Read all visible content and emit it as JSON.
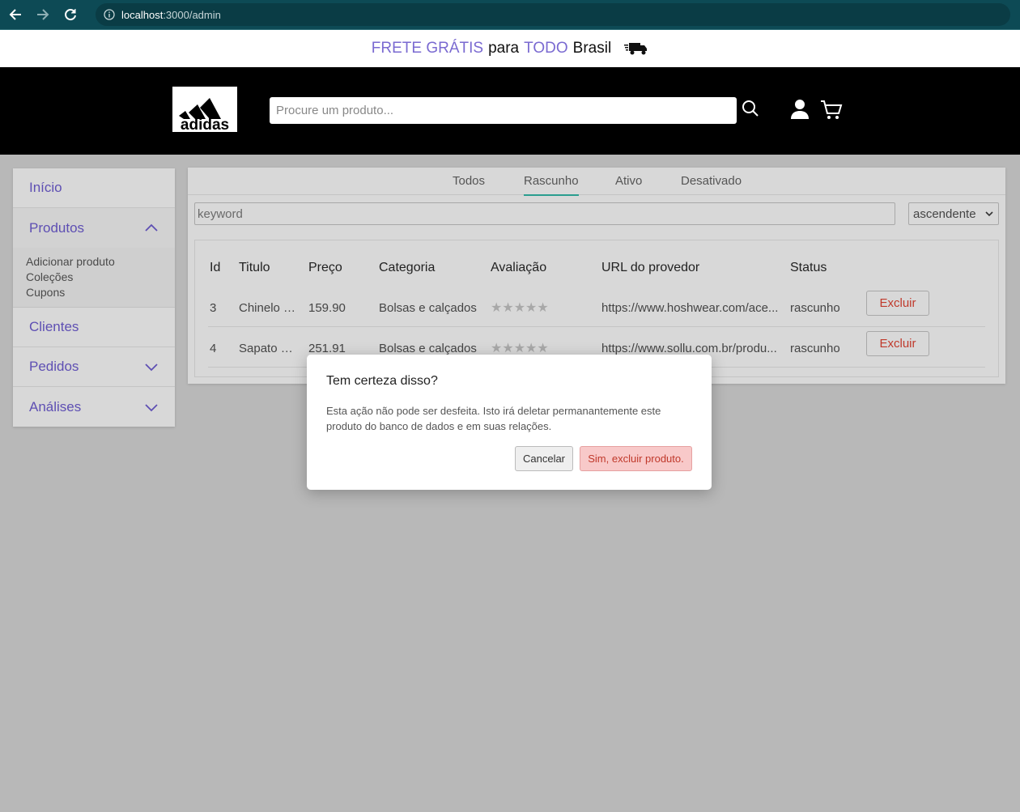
{
  "browser": {
    "url_host": "localhost",
    "url_rest": ":3000/admin"
  },
  "banner": {
    "part1": "FRETE GRÁTIS",
    "part2": "para",
    "part3": "TODO",
    "part4": "Brasil"
  },
  "header": {
    "logo_text": "adidas",
    "search_placeholder": "Procure um produto..."
  },
  "sidebar": {
    "items": [
      {
        "label": "Início"
      },
      {
        "label": "Produtos"
      },
      {
        "label": "Clientes"
      },
      {
        "label": "Pedidos"
      },
      {
        "label": "Análises"
      }
    ],
    "produtos_sub": [
      "Adicionar produto",
      "Coleções",
      "Cupons"
    ]
  },
  "tabs": [
    "Todos",
    "Rascunho",
    "Ativo",
    "Desativado"
  ],
  "filter": {
    "keyword_placeholder": "keyword",
    "order_selected": "ascendente"
  },
  "table": {
    "headers": [
      "Id",
      "Titulo",
      "Preço",
      "Categoria",
      "Avaliação",
      "URL do provedor",
      "Status"
    ],
    "rows": [
      {
        "id": "3",
        "title": "Chinelo ar...",
        "price": "159.90",
        "category": "Bolsas e calçados",
        "rating": "★★★★★",
        "url": "https://www.hoshwear.com/ace...",
        "status": "rascunho",
        "action": "Excluir"
      },
      {
        "id": "4",
        "title": "Sapato m...",
        "price": "251.91",
        "category": "Bolsas e calçados",
        "rating": "★★★★★",
        "url": "https://www.sollu.com.br/produ...",
        "status": "rascunho",
        "action": "Excluir"
      }
    ]
  },
  "modal": {
    "title": "Tem certeza disso?",
    "body": "Esta ação não pode ser desfeita. Isto irá deletar permanantemente este produto do banco de dados e em suas relações.",
    "cancel": "Cancelar",
    "confirm": "Sim, excluir produto."
  },
  "colors": {
    "accent": "#7a6ad1",
    "tab_active": "#2a9d8f",
    "danger": "#c0392b"
  }
}
